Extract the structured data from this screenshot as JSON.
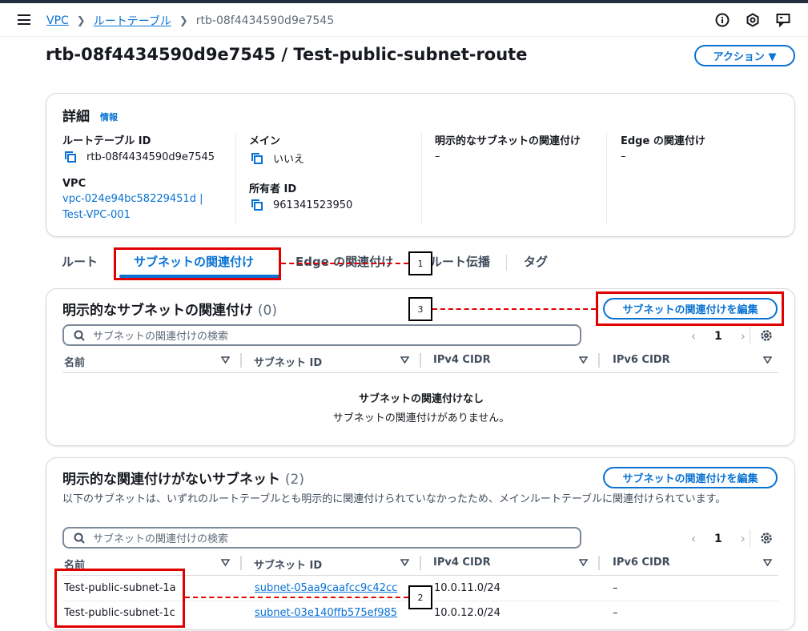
{
  "breadcrumb": {
    "items": [
      "VPC",
      "ルートテーブル",
      "rtb-08f4434590d9e7545"
    ]
  },
  "page": {
    "title": "rtb-08f4434590d9e7545 / Test-public-subnet-route",
    "action_button": "アクション ▼"
  },
  "details": {
    "title": "詳細",
    "info": "情報",
    "route_table_id_label": "ルートテーブル ID",
    "route_table_id": "rtb-08f4434590d9e7545",
    "vpc_label": "VPC",
    "vpc_line1": "vpc-024e94bc58229451d |",
    "vpc_line2": "Test-VPC-001",
    "main_label": "メイン",
    "main_value": "いいえ",
    "owner_label": "所有者 ID",
    "owner_value": "961341523950",
    "explicit_label": "明示的なサブネットの関連付け",
    "explicit_value": "–",
    "edge_label": "Edge の関連付け",
    "edge_value": "–"
  },
  "tabs": [
    "ルート",
    "サブネットの関連付け",
    "Edge の関連付け",
    "ルート伝播",
    "タグ"
  ],
  "explicit_section": {
    "title": "明示的なサブネットの関連付け",
    "count": "(0)",
    "edit_button": "サブネットの関連付けを編集",
    "search_placeholder": "サブネットの関連付けの検索",
    "page": "1",
    "columns": [
      "名前",
      "サブネット ID",
      "IPv4 CIDR",
      "IPv6 CIDR"
    ],
    "empty_title": "サブネットの関連付けなし",
    "empty_sub": "サブネットの関連付けがありません。"
  },
  "implicit_section": {
    "title": "明示的な関連付けがないサブネット",
    "count": "(2)",
    "edit_button": "サブネットの関連付けを編集",
    "description": "以下のサブネットは、いずれのルートテーブルとも明示的に関連付けられていなかったため、メインルートテーブルに関連付けられています。",
    "search_placeholder": "サブネットの関連付けの検索",
    "page": "1",
    "columns": [
      "名前",
      "サブネット ID",
      "IPv4 CIDR",
      "IPv6 CIDR"
    ],
    "rows": [
      {
        "name": "Test-public-subnet-1a",
        "subnet_id": "subnet-05aa9caafcc9c42cc",
        "ipv4": "10.0.11.0/24",
        "ipv6": "–"
      },
      {
        "name": "Test-public-subnet-1c",
        "subnet_id": "subnet-03e140ffb575ef985",
        "ipv4": "10.0.12.0/24",
        "ipv6": "–"
      }
    ]
  },
  "callouts": [
    "1",
    "2",
    "3"
  ],
  "colors": {
    "accent": "#0972d3",
    "annotation": "#e00000",
    "text": "#16191f"
  },
  "icons": [
    "menu-icon",
    "info-icon",
    "settings-hex-icon",
    "feedback-icon",
    "copy-icon",
    "search-icon",
    "gear-icon",
    "sort-icon"
  ]
}
